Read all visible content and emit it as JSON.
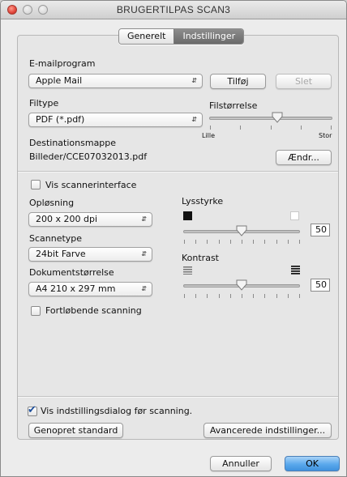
{
  "window": {
    "title": "BRUGERTILPAS SCAN3"
  },
  "tabs": [
    {
      "label": "Generelt",
      "selected": false
    },
    {
      "label": "Indstillinger",
      "selected": true
    }
  ],
  "email": {
    "label": "E-mailprogram",
    "program": "Apple Mail",
    "add_button": "Tilføj",
    "delete_button": "Slet"
  },
  "filetype": {
    "label": "Filtype",
    "value": "PDF (*.pdf)"
  },
  "filesize": {
    "label": "Filstørrelse",
    "min_label": "Lille",
    "max_label": "Stor",
    "level": 0.55
  },
  "destination": {
    "label": "Destinationsmappe",
    "path": "Billeder/CCE07032013.pdf",
    "change_button": "Ændr..."
  },
  "scanner_ui": {
    "label": "Vis scannerinterface",
    "checked": false
  },
  "resolution": {
    "label": "Opløsning",
    "value": "200 x 200 dpi"
  },
  "scantype": {
    "label": "Scannetype",
    "value": "24bit Farve"
  },
  "docsize": {
    "label": "Dokumentstørrelse",
    "value": "A4 210 x 297 mm"
  },
  "continuous": {
    "label": "Fortløbende scanning",
    "checked": false
  },
  "brightness": {
    "label": "Lysstyrke",
    "value": "50",
    "level": 0.5
  },
  "contrast": {
    "label": "Kontrast",
    "value": "50",
    "level": 0.5
  },
  "show_dialog": {
    "label": "Vis indstillingsdialog før scanning.",
    "checked": true
  },
  "buttons": {
    "restore": "Genopret standard",
    "advanced": "Avancerede indstillinger...",
    "cancel": "Annuller",
    "ok": "OK"
  },
  "colors": {
    "accent": "#4a98e6",
    "close": "#e0443a"
  }
}
